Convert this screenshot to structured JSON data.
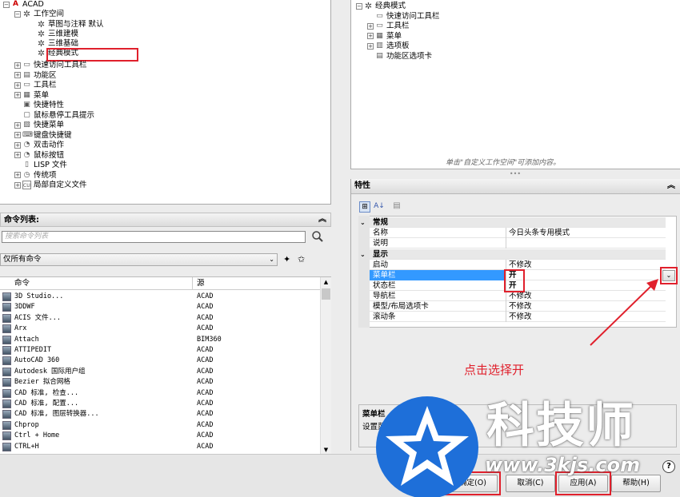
{
  "tree_left": {
    "root": "ACAD",
    "workspace": "工作空间",
    "workspace_items": [
      "草图与注释 默认",
      "三维建模",
      "三维基础",
      "经典模式"
    ],
    "items": [
      "快速访问工具栏",
      "功能区",
      "工具栏",
      "菜单",
      "快捷特性",
      "鼠标悬停工具提示",
      "快捷菜单",
      "键盘快捷键",
      "双击动作",
      "鼠标按钮",
      "LISP 文件",
      "传统项",
      "局部自定义文件"
    ]
  },
  "tree_right": {
    "root": "经典模式",
    "items": [
      "快速访问工具栏",
      "工具栏",
      "菜单",
      "选项板",
      "功能区选项卡"
    ],
    "hint": "单击\"自定义工作空间\"可添加内容。"
  },
  "command_list": {
    "title": "命令列表:",
    "search_placeholder": "搜索命令列表",
    "filter_value": "仅所有命令",
    "col_command": "命令",
    "col_source": "源",
    "rows": [
      {
        "name": "3D Studio...",
        "src": "ACAD"
      },
      {
        "name": "3DDWF",
        "src": "ACAD"
      },
      {
        "name": "ACIS 文件...",
        "src": "ACAD"
      },
      {
        "name": "Arx",
        "src": "ACAD"
      },
      {
        "name": "Attach",
        "src": "BIM360"
      },
      {
        "name": "ATTIPEDIT",
        "src": "ACAD"
      },
      {
        "name": "AutoCAD 360",
        "src": "ACAD"
      },
      {
        "name": "Autodesk 国际用户组",
        "src": "ACAD"
      },
      {
        "name": "Bezier 拟合网格",
        "src": "ACAD"
      },
      {
        "name": "CAD 标准, 检查...",
        "src": "ACAD"
      },
      {
        "name": "CAD 标准, 配置...",
        "src": "ACAD"
      },
      {
        "name": "CAD 标准, 图层转换器...",
        "src": "ACAD"
      },
      {
        "name": "Chprop",
        "src": "ACAD"
      },
      {
        "name": "Ctrl + Home",
        "src": "ACAD"
      },
      {
        "name": "CTRL+H",
        "src": "ACAD"
      }
    ]
  },
  "properties": {
    "title": "特性",
    "group_general": "常规",
    "general_rows": [
      {
        "name": "名称",
        "value": "今日头条专用模式"
      },
      {
        "name": "说明",
        "value": ""
      }
    ],
    "group_display": "显示",
    "display_rows": [
      {
        "name": "启动",
        "value": "不修改"
      },
      {
        "name": "菜单栏",
        "value": "开"
      },
      {
        "name": "状态栏",
        "value": "开"
      },
      {
        "name": "导航栏",
        "value": "不修改"
      },
      {
        "name": "模型/布局选项卡",
        "value": "不修改"
      },
      {
        "name": "滚动条",
        "value": "不修改"
      }
    ],
    "desc_title": "菜单栏",
    "desc_text": "设置菜单栏开/关状态"
  },
  "annotation": "点击选择开",
  "watermark": {
    "brand": "科技师",
    "url": "www.3kjs.com"
  },
  "buttons": {
    "ok": "确定(O)",
    "cancel": "取消(C)",
    "apply": "应用(A)",
    "help": "帮助(H)"
  },
  "colors": {
    "selection": "#3399ff",
    "annotation": "#e0202c",
    "watermark": "#1e6fd9"
  }
}
